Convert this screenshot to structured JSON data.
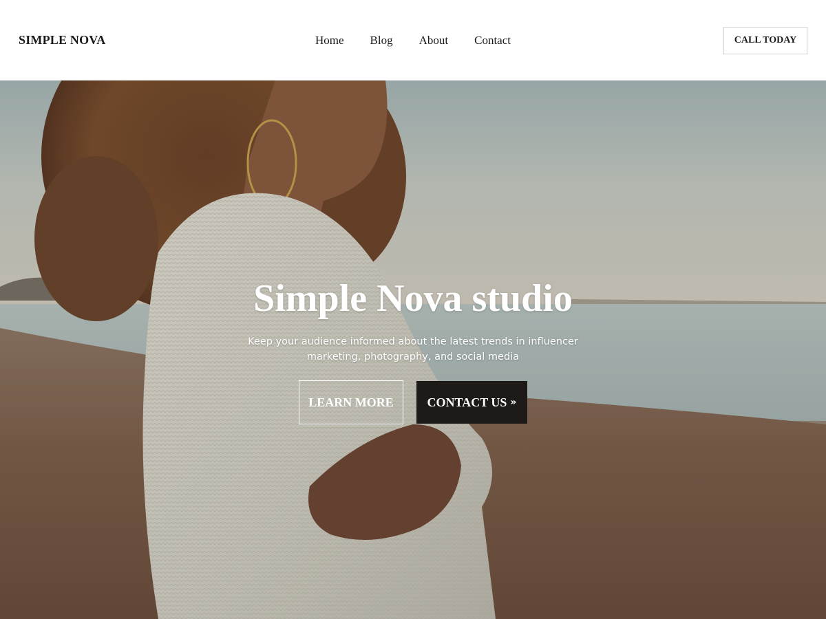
{
  "header": {
    "brand": "SIMPLE NOVA",
    "nav": [
      {
        "label": "Home"
      },
      {
        "label": "Blog"
      },
      {
        "label": "About"
      },
      {
        "label": "Contact"
      }
    ],
    "cta_label": "CALL TODAY"
  },
  "hero": {
    "title": "Simple Nova studio",
    "subtitle": "Keep your audience informed about the latest trends in influencer marketing, photography, and social media",
    "primary_button": "LEARN MORE",
    "secondary_button": "CONTACT US",
    "secondary_icon": "double-chevron-right-icon",
    "secondary_icon_glyph": "»"
  },
  "colors": {
    "header_bg": "#ffffff",
    "text_dark": "#1a1a1a",
    "button_dark": "#1e1a18",
    "hero_text": "#ffffff"
  }
}
